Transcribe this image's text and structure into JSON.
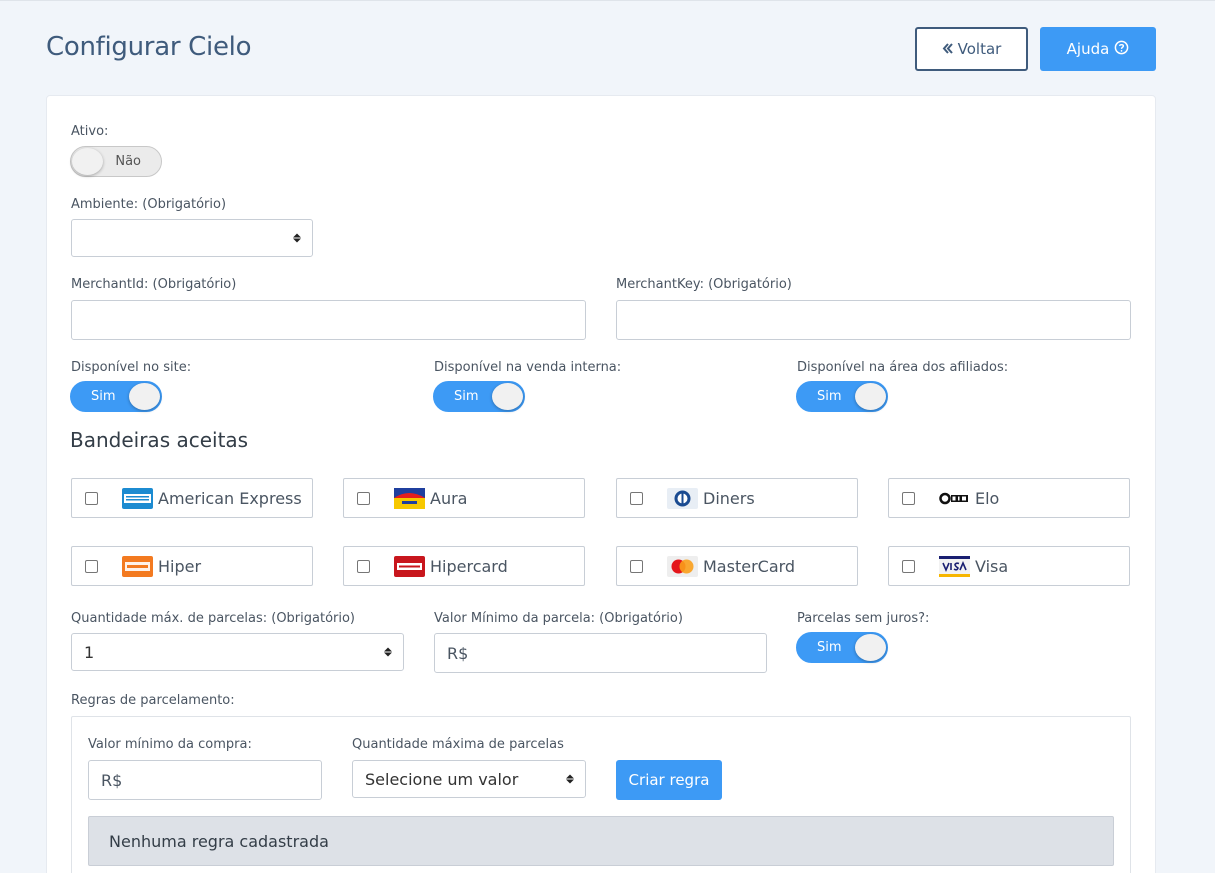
{
  "header": {
    "title": "Configurar Cielo",
    "voltar_label": "Voltar",
    "ajuda_label": "Ajuda"
  },
  "form": {
    "ativo": {
      "label": "Ativo:",
      "toggle_text": "Não",
      "enabled": false
    },
    "ambiente": {
      "label": "Ambiente: (Obrigatório)",
      "value": ""
    },
    "merchant_id": {
      "label": "MerchantId: (Obrigatório)",
      "value": ""
    },
    "merchant_key": {
      "label": "MerchantKey: (Obrigatório)",
      "value": ""
    },
    "disponivel_site": {
      "label": "Disponível no site:",
      "toggle_text": "Sim",
      "enabled": true
    },
    "disponivel_venda": {
      "label": "Disponível na venda interna:",
      "toggle_text": "Sim",
      "enabled": true
    },
    "disponivel_afiliados": {
      "label": "Disponível na área dos afiliados:",
      "toggle_text": "Sim",
      "enabled": true
    },
    "bandeiras_title": "Bandeiras aceitas",
    "bandeiras": [
      {
        "name": "American Express",
        "icon": "amex-icon",
        "checked": false
      },
      {
        "name": "Aura",
        "icon": "aura-icon",
        "checked": false
      },
      {
        "name": "Diners",
        "icon": "diners-icon",
        "checked": false
      },
      {
        "name": "Elo",
        "icon": "elo-icon",
        "checked": false
      },
      {
        "name": "Hiper",
        "icon": "hiper-icon",
        "checked": false
      },
      {
        "name": "Hipercard",
        "icon": "hipercard-icon",
        "checked": false
      },
      {
        "name": "MasterCard",
        "icon": "mastercard-icon",
        "checked": false
      },
      {
        "name": "Visa",
        "icon": "visa-icon",
        "checked": false
      }
    ],
    "qtd_parcelas": {
      "label": "Quantidade máx. de parcelas: (Obrigatório)",
      "value": "1"
    },
    "valor_minimo_parcela": {
      "label": "Valor Mínimo da parcela: (Obrigatório)",
      "placeholder": "R$"
    },
    "parcelas_sem_juros": {
      "label": "Parcelas sem juros?:",
      "toggle_text": "Sim",
      "enabled": true
    },
    "regras": {
      "label": "Regras de parcelamento:",
      "valor_minimo_compra_label": "Valor mínimo da compra:",
      "valor_minimo_compra_placeholder": "R$",
      "qtd_max_label": "Quantidade máxima de parcelas",
      "qtd_max_value": "Selecione um valor",
      "criar_label": "Criar regra",
      "empty_text": "Nenhuma regra cadastrada"
    }
  }
}
